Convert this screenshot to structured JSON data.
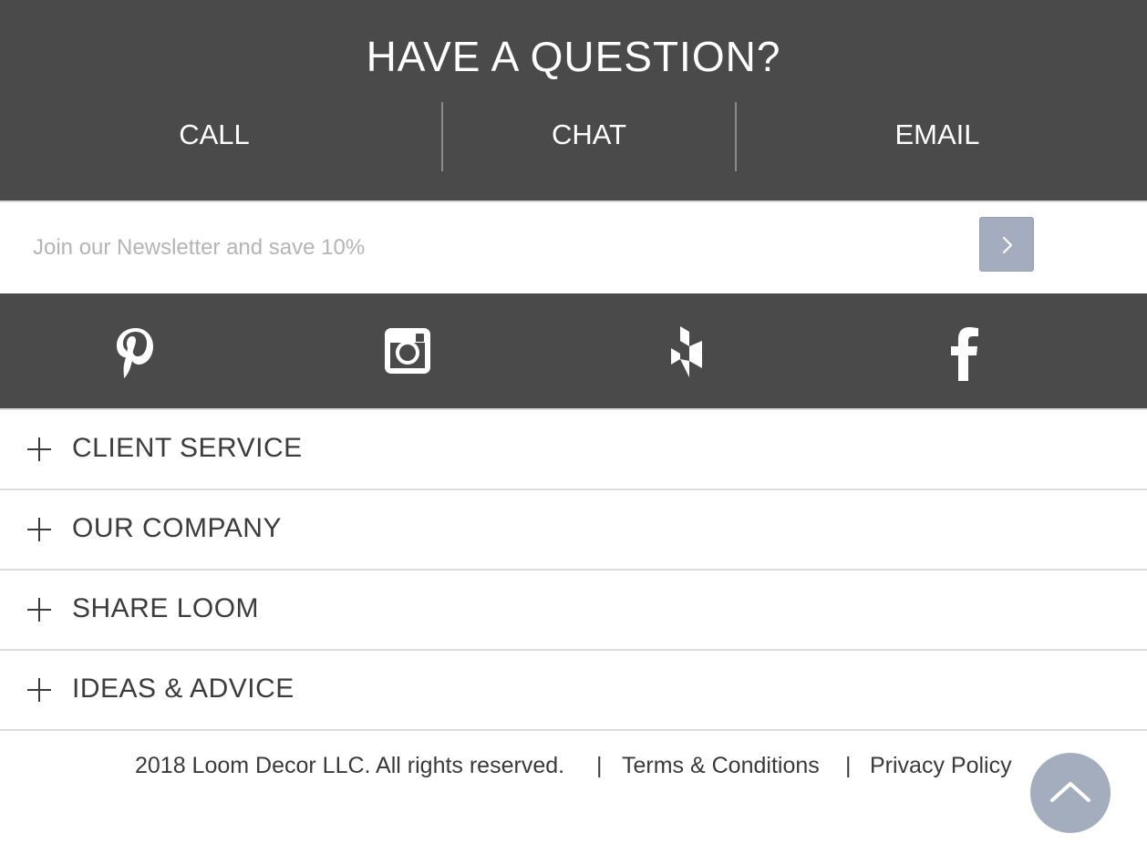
{
  "contact": {
    "title": "HAVE A QUESTION?",
    "options": [
      {
        "label": "CALL"
      },
      {
        "label": "CHAT"
      },
      {
        "label": "EMAIL"
      }
    ],
    "colors": {
      "background": "#4a4a4a",
      "text": "#ffffff"
    }
  },
  "newsletter": {
    "placeholder": "Join our Newsletter and save 10%",
    "value": "",
    "submit_icon": "chevron-right-icon",
    "colors": {
      "button": "#a3adbd"
    }
  },
  "social": {
    "icons": [
      "pinterest-icon",
      "instagram-icon",
      "houzz-icon",
      "facebook-icon"
    ]
  },
  "accordion": {
    "items": [
      {
        "label": "CLIENT SERVICE",
        "icon": "plus-icon"
      },
      {
        "label": "OUR COMPANY",
        "icon": "plus-icon"
      },
      {
        "label": "SHARE LOOM",
        "icon": "plus-icon"
      },
      {
        "label": "IDEAS & ADVICE",
        "icon": "plus-icon"
      }
    ]
  },
  "footer": {
    "copyright": "2018 Loom Decor LLC. All rights reserved.",
    "separator": "|",
    "links": [
      {
        "label": "Terms & Conditions"
      },
      {
        "label": "Privacy Policy"
      }
    ],
    "back_to_top_icon": "chevron-up-icon"
  }
}
